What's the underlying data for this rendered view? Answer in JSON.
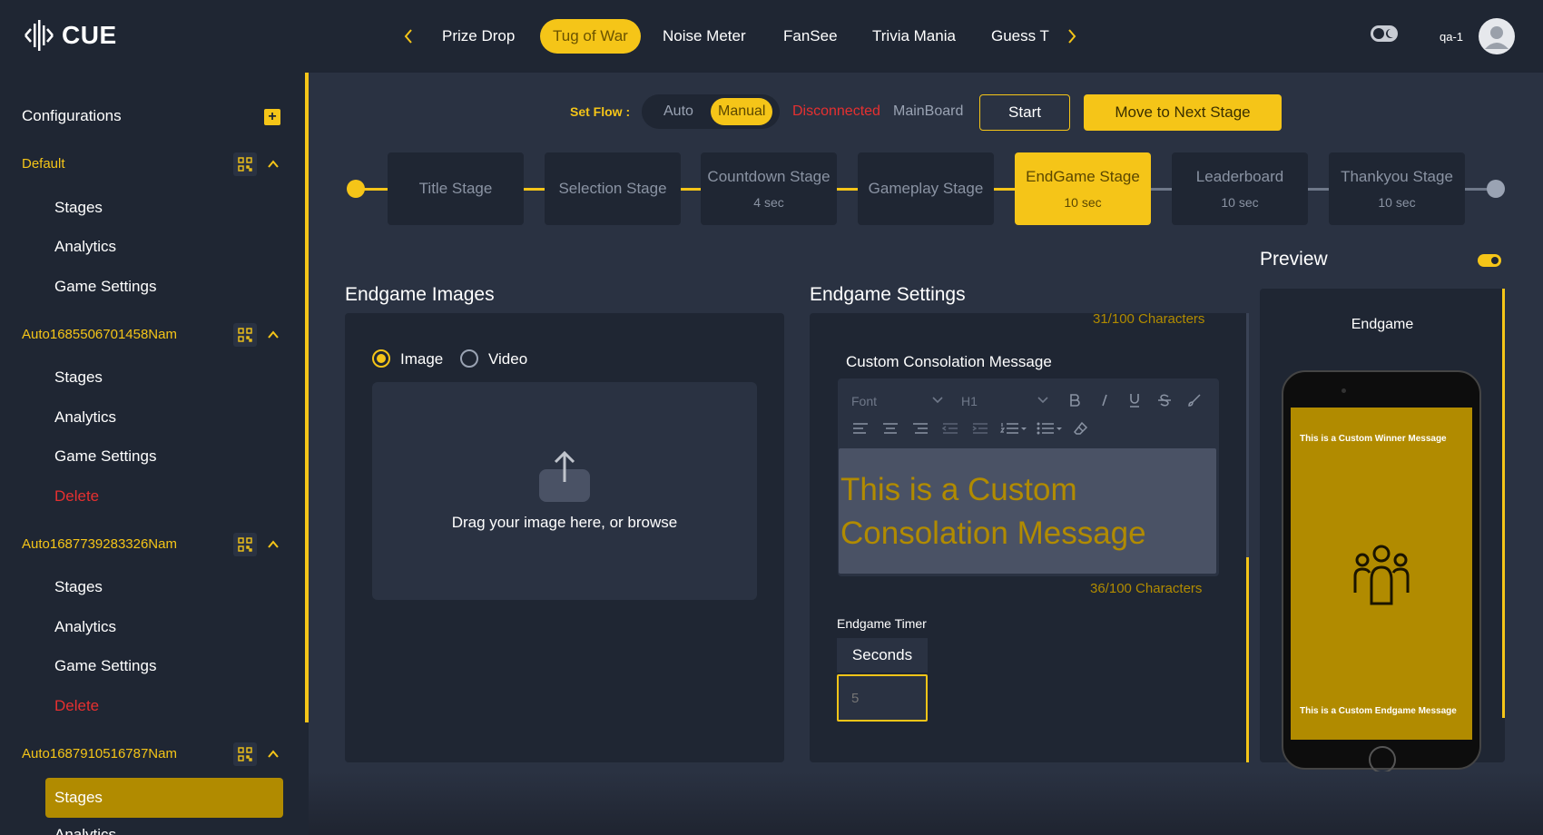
{
  "app": {
    "logo_text": "CUE"
  },
  "games": {
    "tabs": [
      {
        "label": "Prize Drop",
        "active": false
      },
      {
        "label": "Tug of War",
        "active": true
      },
      {
        "label": "Noise Meter",
        "active": false
      },
      {
        "label": "FanSee",
        "active": false
      },
      {
        "label": "Trivia Mania",
        "active": false
      },
      {
        "label": "Guess T",
        "active": false
      }
    ]
  },
  "header": {
    "user_name": "qa-1",
    "theme_toggle_icon": "moon-toggle-icon"
  },
  "sidebar": {
    "title": "Configurations",
    "add_label": "+",
    "groups": [
      {
        "name": "Default",
        "items": [
          "Stages",
          "Analytics",
          "Game Settings"
        ]
      },
      {
        "name": "Auto1685506701458Nam",
        "items": [
          "Stages",
          "Analytics",
          "Game Settings",
          "Delete"
        ]
      },
      {
        "name": "Auto1687739283326Nam",
        "items": [
          "Stages",
          "Analytics",
          "Game Settings",
          "Delete"
        ]
      },
      {
        "name": "Auto1687910516787Nam",
        "items": [
          "Stages",
          "Analytics"
        ],
        "active_item": "Stages"
      }
    ]
  },
  "flow": {
    "label": "Set Flow :",
    "options": [
      "Auto",
      "Manual"
    ],
    "selected": "Manual",
    "status": "Disconnected",
    "board": "MainBoard",
    "start_label": "Start",
    "next_label": "Move to Next Stage"
  },
  "stages": [
    {
      "name": "Title Stage",
      "duration": ""
    },
    {
      "name": "Selection Stage",
      "duration": ""
    },
    {
      "name": "Countdown Stage",
      "duration": "4 sec"
    },
    {
      "name": "Gameplay Stage",
      "duration": ""
    },
    {
      "name": "EndGame Stage",
      "duration": "10 sec",
      "active": true
    },
    {
      "name": "Leaderboard",
      "duration": "10 sec"
    },
    {
      "name": "Thankyou Stage",
      "duration": "10 sec"
    }
  ],
  "images": {
    "title": "Endgame Images",
    "media_types": [
      "Image",
      "Video"
    ],
    "selected_media": "Image",
    "drop_text": "Drag your image here, or browse"
  },
  "settings": {
    "title": "Endgame Settings",
    "top_char_count": "31/100 Characters",
    "consolation_label": "Custom Consolation Message",
    "toolbar": {
      "font": "Font",
      "heading": "H1"
    },
    "consolation_text": "This is a Custom Consolation Message",
    "consolation_count": "36/100 Characters",
    "timer_label": "Endgame Timer",
    "timer_unit": "Seconds",
    "timer_placeholder": "5"
  },
  "preview": {
    "title": "Preview",
    "screen_name": "Endgame",
    "winner_msg": "This is a Custom Winner Message",
    "endgame_msg": "This is a Custom Endgame Message",
    "screen_color": "#b18b00"
  },
  "colors": {
    "accent": "#f5c518",
    "danger": "#e63030",
    "bg": "#1f2633",
    "panel": "#2a3242"
  }
}
